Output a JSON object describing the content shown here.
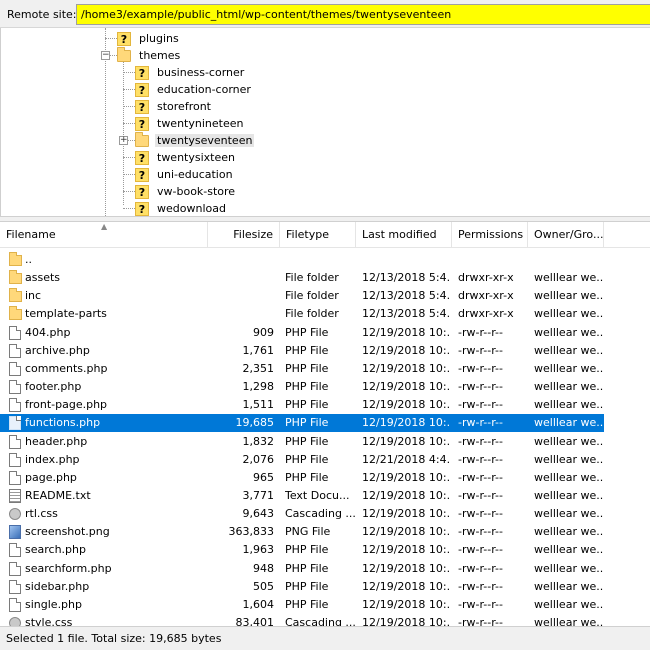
{
  "remote_site": {
    "label": "Remote site:",
    "path": "/home3/example/public_html/wp-content/themes/twentyseventeen"
  },
  "tree": {
    "items": [
      {
        "label": "plugins",
        "icon": "question-icon"
      },
      {
        "label": "themes",
        "icon": "folder-icon"
      },
      {
        "label": "business-corner",
        "icon": "question-icon"
      },
      {
        "label": "education-corner",
        "icon": "question-icon"
      },
      {
        "label": "storefront",
        "icon": "question-icon"
      },
      {
        "label": "twentynineteen",
        "icon": "question-icon"
      },
      {
        "label": "twentyseventeen",
        "icon": "folder-icon",
        "selected": true
      },
      {
        "label": "twentysixteen",
        "icon": "question-icon"
      },
      {
        "label": "uni-education",
        "icon": "question-icon"
      },
      {
        "label": "vw-book-store",
        "icon": "question-icon"
      },
      {
        "label": "wedownload",
        "icon": "question-icon"
      }
    ]
  },
  "columns": {
    "filename": "Filename",
    "filesize": "Filesize",
    "filetype": "Filetype",
    "modified": "Last modified",
    "permissions": "Permissions",
    "owner": "Owner/Gro..."
  },
  "files": [
    {
      "name": "..",
      "size": "",
      "type": "",
      "modified": "",
      "perms": "",
      "owner": "",
      "icon": "folder"
    },
    {
      "name": "assets",
      "size": "",
      "type": "File folder",
      "modified": "12/13/2018 5:4...",
      "perms": "drwxr-xr-x",
      "owner": "welllear we...",
      "icon": "folder"
    },
    {
      "name": "inc",
      "size": "",
      "type": "File folder",
      "modified": "12/13/2018 5:4...",
      "perms": "drwxr-xr-x",
      "owner": "welllear we...",
      "icon": "folder"
    },
    {
      "name": "template-parts",
      "size": "",
      "type": "File folder",
      "modified": "12/13/2018 5:4...",
      "perms": "drwxr-xr-x",
      "owner": "welllear we...",
      "icon": "folder"
    },
    {
      "name": "404.php",
      "size": "909",
      "type": "PHP File",
      "modified": "12/19/2018 10:...",
      "perms": "-rw-r--r--",
      "owner": "welllear we...",
      "icon": "file"
    },
    {
      "name": "archive.php",
      "size": "1,761",
      "type": "PHP File",
      "modified": "12/19/2018 10:...",
      "perms": "-rw-r--r--",
      "owner": "welllear we...",
      "icon": "file"
    },
    {
      "name": "comments.php",
      "size": "2,351",
      "type": "PHP File",
      "modified": "12/19/2018 10:...",
      "perms": "-rw-r--r--",
      "owner": "welllear we...",
      "icon": "file"
    },
    {
      "name": "footer.php",
      "size": "1,298",
      "type": "PHP File",
      "modified": "12/19/2018 10:...",
      "perms": "-rw-r--r--",
      "owner": "welllear we...",
      "icon": "file"
    },
    {
      "name": "front-page.php",
      "size": "1,511",
      "type": "PHP File",
      "modified": "12/19/2018 10:...",
      "perms": "-rw-r--r--",
      "owner": "welllear we...",
      "icon": "file"
    },
    {
      "name": "functions.php",
      "size": "19,685",
      "type": "PHP File",
      "modified": "12/19/2018 10:...",
      "perms": "-rw-r--r--",
      "owner": "welllear we...",
      "icon": "file",
      "selected": true
    },
    {
      "name": "header.php",
      "size": "1,832",
      "type": "PHP File",
      "modified": "12/19/2018 10:...",
      "perms": "-rw-r--r--",
      "owner": "welllear we...",
      "icon": "file"
    },
    {
      "name": "index.php",
      "size": "2,076",
      "type": "PHP File",
      "modified": "12/21/2018 4:4...",
      "perms": "-rw-r--r--",
      "owner": "welllear we...",
      "icon": "file"
    },
    {
      "name": "page.php",
      "size": "965",
      "type": "PHP File",
      "modified": "12/19/2018 10:...",
      "perms": "-rw-r--r--",
      "owner": "welllear we...",
      "icon": "file"
    },
    {
      "name": "README.txt",
      "size": "3,771",
      "type": "Text Docu...",
      "modified": "12/19/2018 10:...",
      "perms": "-rw-r--r--",
      "owner": "welllear we...",
      "icon": "txt"
    },
    {
      "name": "rtl.css",
      "size": "9,643",
      "type": "Cascading ...",
      "modified": "12/19/2018 10:...",
      "perms": "-rw-r--r--",
      "owner": "welllear we...",
      "icon": "css"
    },
    {
      "name": "screenshot.png",
      "size": "363,833",
      "type": "PNG File",
      "modified": "12/19/2018 10:...",
      "perms": "-rw-r--r--",
      "owner": "welllear we...",
      "icon": "png"
    },
    {
      "name": "search.php",
      "size": "1,963",
      "type": "PHP File",
      "modified": "12/19/2018 10:...",
      "perms": "-rw-r--r--",
      "owner": "welllear we...",
      "icon": "file"
    },
    {
      "name": "searchform.php",
      "size": "948",
      "type": "PHP File",
      "modified": "12/19/2018 10:...",
      "perms": "-rw-r--r--",
      "owner": "welllear we...",
      "icon": "file"
    },
    {
      "name": "sidebar.php",
      "size": "505",
      "type": "PHP File",
      "modified": "12/19/2018 10:...",
      "perms": "-rw-r--r--",
      "owner": "welllear we...",
      "icon": "file"
    },
    {
      "name": "single.php",
      "size": "1,604",
      "type": "PHP File",
      "modified": "12/19/2018 10:...",
      "perms": "-rw-r--r--",
      "owner": "welllear we...",
      "icon": "file"
    },
    {
      "name": "style.css",
      "size": "83,401",
      "type": "Cascading ...",
      "modified": "12/19/2018 10:...",
      "perms": "-rw-r--r--",
      "owner": "welllear we...",
      "icon": "css"
    }
  ],
  "status": {
    "text": "Selected 1 file. Total size: 19,685 bytes"
  },
  "colors": {
    "path_highlight": "#ffff00",
    "selection": "#0078d7"
  }
}
